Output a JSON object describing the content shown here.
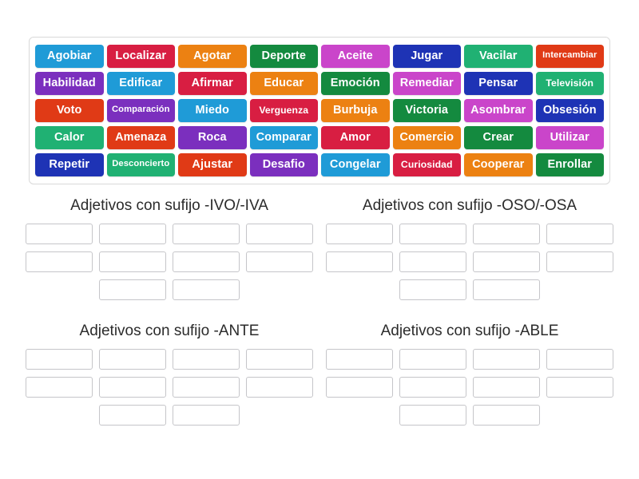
{
  "activity": {
    "type": "group-sort",
    "tray_tile_rows": 5,
    "tray_tile_columns": 8
  },
  "tiles": [
    [
      {
        "label": "Agobiar",
        "color": "#1f9bd7",
        "size": "normal"
      },
      {
        "label": "Localizar",
        "color": "#d81e42",
        "size": "normal"
      },
      {
        "label": "Agotar",
        "color": "#ec8112",
        "size": "normal"
      },
      {
        "label": "Deporte",
        "color": "#148a3f",
        "size": "normal"
      },
      {
        "label": "Aceite",
        "color": "#ca45ca",
        "size": "normal"
      },
      {
        "label": "Jugar",
        "color": "#1e33b5",
        "size": "normal"
      },
      {
        "label": "Vacilar",
        "color": "#20b173",
        "size": "normal"
      },
      {
        "label": "Intercambiar",
        "color": "#e03a16",
        "size": "xs"
      }
    ],
    [
      {
        "label": "Habilidad",
        "color": "#7b2fbe",
        "size": "normal"
      },
      {
        "label": "Edificar",
        "color": "#1f9bd7",
        "size": "normal"
      },
      {
        "label": "Afirmar",
        "color": "#d81e42",
        "size": "normal"
      },
      {
        "label": "Educar",
        "color": "#ec8112",
        "size": "normal"
      },
      {
        "label": "Emoción",
        "color": "#148a3f",
        "size": "normal"
      },
      {
        "label": "Remediar",
        "color": "#ca45ca",
        "size": "normal"
      },
      {
        "label": "Pensar",
        "color": "#1e33b5",
        "size": "normal"
      },
      {
        "label": "Televisión",
        "color": "#20b173",
        "size": "sm"
      }
    ],
    [
      {
        "label": "Voto",
        "color": "#e03a16",
        "size": "normal"
      },
      {
        "label": "Comparación",
        "color": "#7b2fbe",
        "size": "xs"
      },
      {
        "label": "Miedo",
        "color": "#1f9bd7",
        "size": "normal"
      },
      {
        "label": "Verguenza",
        "color": "#d81e42",
        "size": "sm"
      },
      {
        "label": "Burbuja",
        "color": "#ec8112",
        "size": "normal"
      },
      {
        "label": "Victoria",
        "color": "#148a3f",
        "size": "normal"
      },
      {
        "label": "Asombrar",
        "color": "#ca45ca",
        "size": "normal"
      },
      {
        "label": "Obsesión",
        "color": "#1e33b5",
        "size": "normal"
      }
    ],
    [
      {
        "label": "Calor",
        "color": "#20b173",
        "size": "normal"
      },
      {
        "label": "Amenaza",
        "color": "#e03a16",
        "size": "normal"
      },
      {
        "label": "Roca",
        "color": "#7b2fbe",
        "size": "normal"
      },
      {
        "label": "Comparar",
        "color": "#1f9bd7",
        "size": "normal"
      },
      {
        "label": "Amor",
        "color": "#d81e42",
        "size": "normal"
      },
      {
        "label": "Comercio",
        "color": "#ec8112",
        "size": "normal"
      },
      {
        "label": "Crear",
        "color": "#148a3f",
        "size": "normal"
      },
      {
        "label": "Utilizar",
        "color": "#ca45ca",
        "size": "normal"
      }
    ],
    [
      {
        "label": "Repetir",
        "color": "#1e33b5",
        "size": "normal"
      },
      {
        "label": "Desconcierto",
        "color": "#20b173",
        "size": "xs"
      },
      {
        "label": "Ajustar",
        "color": "#e03a16",
        "size": "normal"
      },
      {
        "label": "Desafio",
        "color": "#7b2fbe",
        "size": "normal"
      },
      {
        "label": "Congelar",
        "color": "#1f9bd7",
        "size": "normal"
      },
      {
        "label": "Curiosidad",
        "color": "#d81e42",
        "size": "sm"
      },
      {
        "label": "Cooperar",
        "color": "#ec8112",
        "size": "normal"
      },
      {
        "label": "Enrollar",
        "color": "#148a3f",
        "size": "normal"
      }
    ]
  ],
  "categories": [
    {
      "title": "Adjetivos con sufijo -IVO/-IVA",
      "slot_rows": [
        4,
        4,
        2
      ]
    },
    {
      "title": "Adjetivos con sufijo -OSO/-OSA",
      "slot_rows": [
        4,
        4,
        2
      ]
    },
    {
      "title": "Adjetivos con sufijo -ANTE",
      "slot_rows": [
        4,
        4,
        2
      ]
    },
    {
      "title": "Adjetivos con sufijo -ABLE",
      "slot_rows": [
        4,
        4,
        2
      ]
    }
  ]
}
